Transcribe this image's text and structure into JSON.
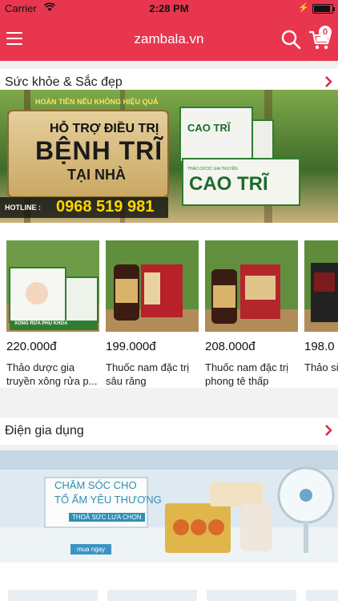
{
  "status_bar": {
    "carrier": "Carrier",
    "time": "2:28 PM"
  },
  "nav": {
    "title": "zambala.vn",
    "cart_count": "0"
  },
  "sections": [
    {
      "title": "Sức khỏe & Sắc đẹp",
      "banner": {
        "guarantee": "HOÀN TIỀN NẾU KHÔNG HIỆU QUẢ",
        "line1": "HỖ TRỢ ĐIỀU TRỊ",
        "line2": "BỆNH TRĨ",
        "line3": "TẠI NHÀ",
        "hotline_label": "HOTLINE :",
        "hotline": "0968 519 981",
        "brand": "CAO TRĨ",
        "brand_small": "THẢO DƯỢC GIA TRUYỀN"
      },
      "products": [
        {
          "price": "220.000đ",
          "name": "Thảo dược gia truyền xông rửa p...",
          "img_label": "XÔNG RỬA PHỤ KHOA"
        },
        {
          "price": "199.000đ",
          "name": "Thuốc nam đặc trị sâu răng",
          "img_label": ""
        },
        {
          "price": "208.000đ",
          "name": "Thuốc nam đặc trị phong tê thấp",
          "img_label": ""
        },
        {
          "price": "198.0",
          "name": "Thảo sinh",
          "img_label": ""
        }
      ]
    },
    {
      "title": "Điện gia dụng",
      "banner": {
        "line1": "CHĂM SÓC CHO",
        "line2": "TỔ ẤM YÊU THƯƠNG",
        "tagline": "THOẢ SỨC LỰA CHỌN",
        "cta": "mua ngay"
      }
    }
  ],
  "colors": {
    "accent": "#e8364e",
    "green": "#2e8b3a"
  },
  "icons": [
    "menu-icon",
    "search-icon",
    "cart-icon",
    "chevron-right-icon",
    "wifi-icon",
    "battery-icon"
  ]
}
